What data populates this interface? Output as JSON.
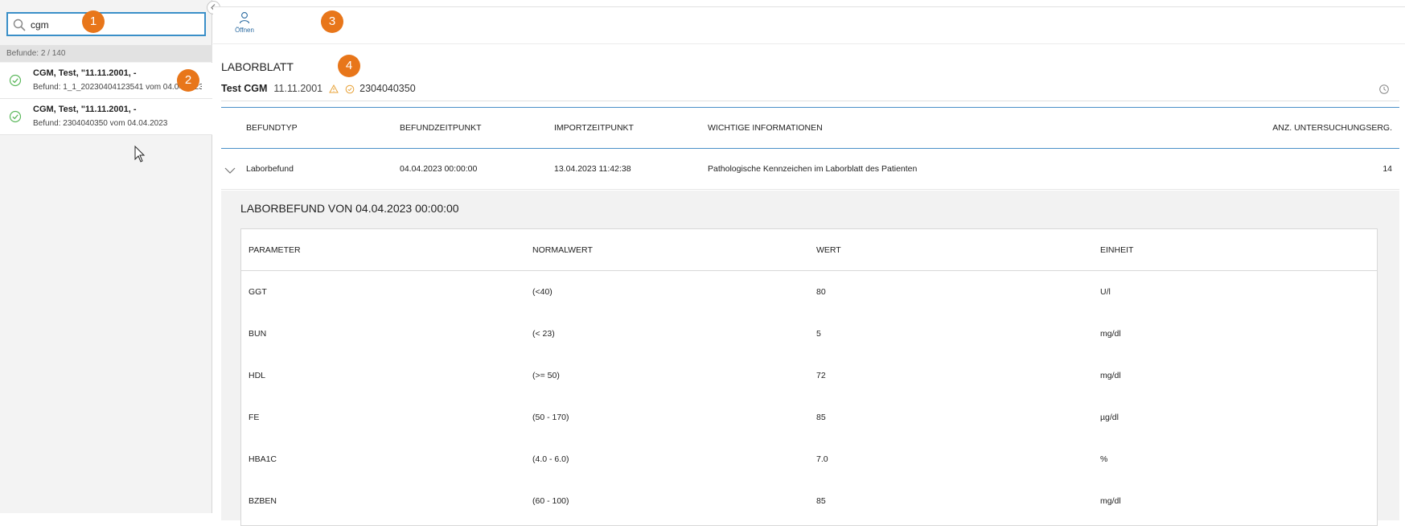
{
  "search": {
    "value": "cgm"
  },
  "results_count": "Befunde: 2 / 140",
  "results": [
    {
      "title": "CGM, Test, \"11.11.2001, -",
      "subtitle": "Befund: 1_1_20230404123541 vom 04.04.2023"
    },
    {
      "title": "CGM, Test, \"11.11.2001, -",
      "subtitle": "Befund: 2304040350 vom 04.04.2023"
    }
  ],
  "badges": [
    "1",
    "2",
    "3",
    "4"
  ],
  "toolbar": {
    "open_label": "Öffnen"
  },
  "sheet": {
    "title": "LABORBLATT"
  },
  "patient": {
    "name": "Test CGM",
    "birthdate": "11.11.2001",
    "id": "2304040350"
  },
  "findings": {
    "headers": [
      "BEFUNDTYP",
      "BEFUNDZEITPUNKT",
      "IMPORTZEITPUNKT",
      "WICHTIGE INFORMATIONEN",
      "ANZ. UNTERSUCHUNGSERG."
    ],
    "row": {
      "type": "Laborbefund",
      "befund_time": "04.04.2023 00:00:00",
      "import_time": "13.04.2023 11:42:38",
      "info": "Pathologische Kennzeichen im Laborblatt des Patienten",
      "count": "14"
    }
  },
  "detail": {
    "title": "LABORBEFUND VON 04.04.2023 00:00:00",
    "headers": [
      "PARAMETER",
      "NORMALWERT",
      "WERT",
      "EINHEIT"
    ],
    "rows": [
      {
        "parameter": "GGT",
        "normal": "(<40)",
        "value": "80",
        "unit": "U/l"
      },
      {
        "parameter": "BUN",
        "normal": "(< 23)",
        "value": "5",
        "unit": "mg/dl"
      },
      {
        "parameter": "HDL",
        "normal": "(>= 50)",
        "value": "72",
        "unit": "mg/dl"
      },
      {
        "parameter": "FE",
        "normal": "(50 - 170)",
        "value": "85",
        "unit": "µg/dl"
      },
      {
        "parameter": "HBA1C",
        "normal": "(4.0 - 6.0)",
        "value": "7.0",
        "unit": "%"
      },
      {
        "parameter": "BZBEN",
        "normal": "(60 - 100)",
        "value": "85",
        "unit": "mg/dl"
      }
    ]
  },
  "colors": {
    "accent": "#3a8fc8",
    "badge": "#e8761a",
    "check": "#5cb85c",
    "warning": "#e8a33a"
  }
}
